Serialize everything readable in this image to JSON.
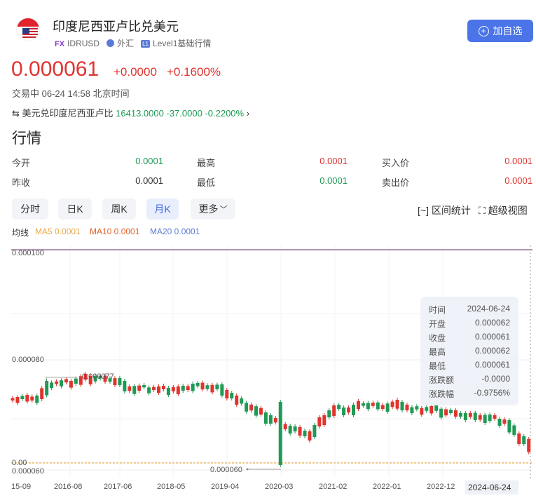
{
  "header": {
    "title": "印度尼西亚卢比兑美元",
    "fx_badge": "FX",
    "symbol": "IDRUSD",
    "market": "外汇",
    "level_badge": "L1",
    "level": "Level1基础行情",
    "add_button": "加自选"
  },
  "quote": {
    "price": "0.000061",
    "change": "+0.0000",
    "change_pct": "+0.1600%",
    "status": "交易中 06-24 14:58 北京时间"
  },
  "reverse": {
    "name": "美元兑印度尼西亚卢比",
    "price": "16413.0000",
    "change": "-37.0000",
    "change_pct": "-0.2200%"
  },
  "section_title": "行情",
  "stats": [
    {
      "label": "今开",
      "value": "0.0001",
      "color": "#1f9a55"
    },
    {
      "label": "最高",
      "value": "0.0001",
      "color": "#e0342f"
    },
    {
      "label": "买入价",
      "value": "0.0001",
      "color": "#e0342f"
    },
    {
      "label": "昨收",
      "value": "0.0001",
      "color": "#333333"
    },
    {
      "label": "最低",
      "value": "0.0001",
      "color": "#1f9a55"
    },
    {
      "label": "卖出价",
      "value": "0.0001",
      "color": "#e0342f"
    }
  ],
  "tabs": [
    "分时",
    "日K",
    "周K",
    "月K",
    "更多"
  ],
  "active_tab": "月K",
  "tools": {
    "range_stats": "区间统计",
    "super_view": "超级视图"
  },
  "ma": {
    "label": "均线",
    "ma5": "MA5 0.0001",
    "ma10": "MA10 0.0001",
    "ma20": "MA20 0.0001"
  },
  "colors": {
    "up": "#e0342f",
    "down": "#1f9a55",
    "accent": "#4a74e8",
    "ma5": "#e8a94a",
    "ma10": "#e0642f",
    "ma20": "#5b7bd6"
  },
  "chart_data": {
    "type": "candlestick",
    "y_ticks": [
      "0.000100",
      "0.000080",
      "0.000060"
    ],
    "x_ticks": [
      "15-09",
      "2016-08",
      "2017-06",
      "2018-05",
      "2019-04",
      "2020-03",
      "2021-02",
      "2022-01",
      "2022-12",
      "2024-06-24"
    ],
    "left_axis_current": "0.00",
    "annotations": {
      "max": "0.000077",
      "min": "0.000060"
    },
    "ylim": [
      6e-05,
      0.0001
    ],
    "crosshair": {
      "date": "2024-06-24"
    }
  },
  "tooltip": [
    {
      "label": "时间",
      "value": "2024-06-24"
    },
    {
      "label": "开盘",
      "value": "0.000062"
    },
    {
      "label": "收盘",
      "value": "0.000061"
    },
    {
      "label": "最高",
      "value": "0.000062"
    },
    {
      "label": "最低",
      "value": "0.000061"
    },
    {
      "label": "涨跌额",
      "value": "-0.0000"
    },
    {
      "label": "涨跌幅",
      "value": "-0.9756%"
    }
  ]
}
